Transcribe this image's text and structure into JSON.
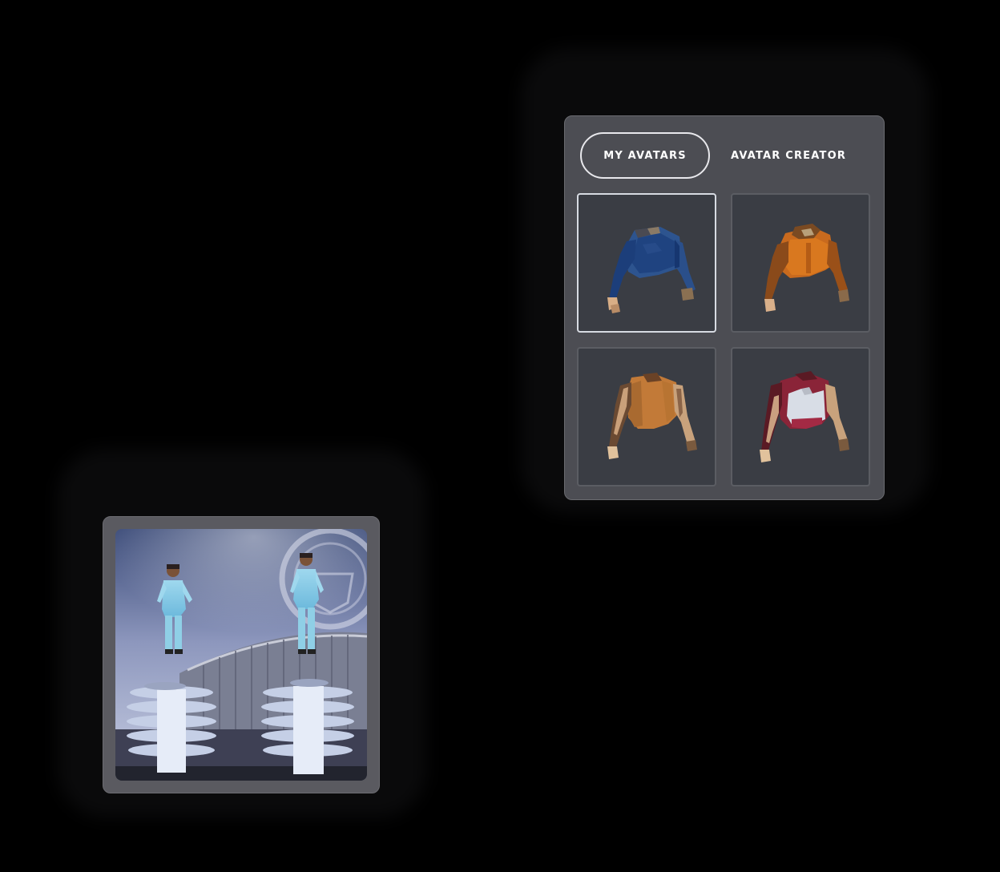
{
  "tabs": {
    "my_avatars": "MY AVATARS",
    "avatar_creator": "AVATAR CREATOR"
  },
  "avatars": [
    {
      "name": "blue-jersey-avatar",
      "color": "#2a4f8a",
      "selected": true
    },
    {
      "name": "orange-jacket-avatar",
      "color": "#c8661a",
      "selected": false
    },
    {
      "name": "brown-shirt-avatar",
      "color": "#c27a38",
      "selected": false
    },
    {
      "name": "maroon-white-shirt-avatar",
      "color": "#8a2438",
      "selected": false
    }
  ],
  "photo": {
    "description_icon": "stadium-players-image"
  }
}
